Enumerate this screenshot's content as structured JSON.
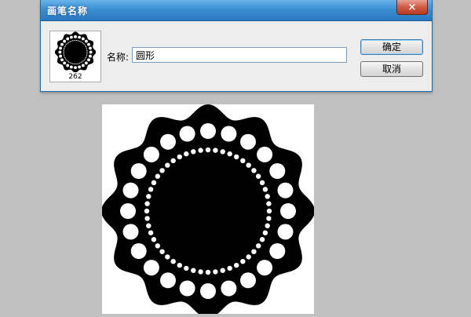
{
  "dialog": {
    "title": "画笔名称",
    "close_label": "×",
    "thumbnail_count": "262",
    "name_label": "名称:",
    "name_value": "圆形",
    "ok_label": "确定",
    "cancel_label": "取消"
  }
}
